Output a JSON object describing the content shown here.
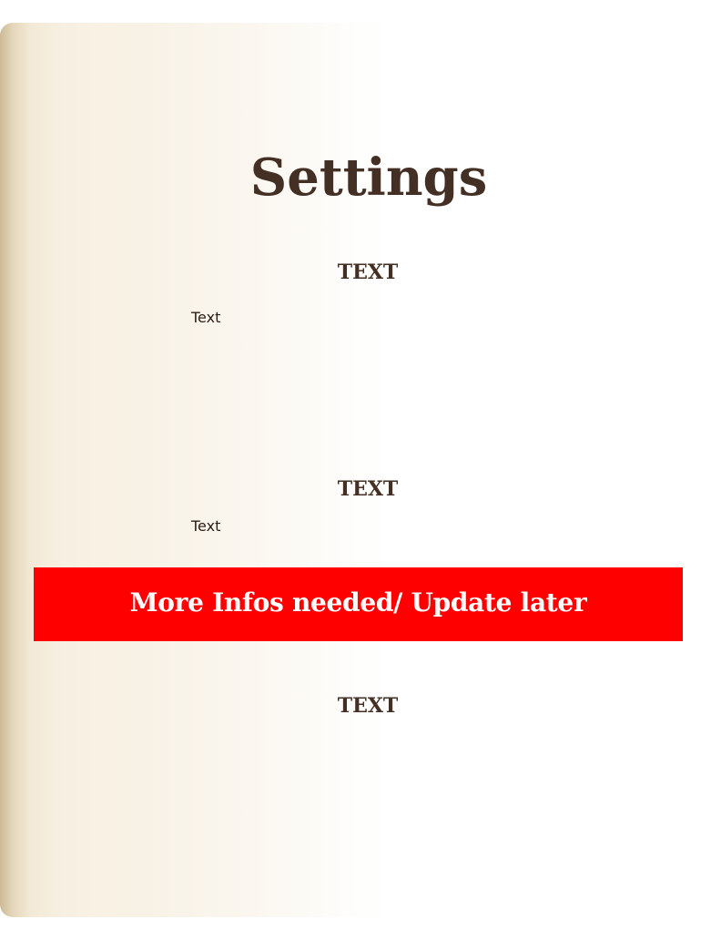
{
  "page": {
    "title": "Settings"
  },
  "sections": [
    {
      "heading": "TEXT",
      "body": "Text"
    },
    {
      "heading": "TEXT",
      "body": "Text"
    },
    {
      "heading": "TEXT",
      "body": ""
    }
  ],
  "banner": {
    "text": "More Infos needed/ Update later",
    "background_color": "#ff0000",
    "text_color": "#ffffff"
  },
  "colors": {
    "heading_text": "#432f23",
    "body_text": "#2b1d15",
    "paper_left": "#cdb995",
    "paper_mid": "#f8f2e6",
    "paper_right": "#ffffff"
  }
}
